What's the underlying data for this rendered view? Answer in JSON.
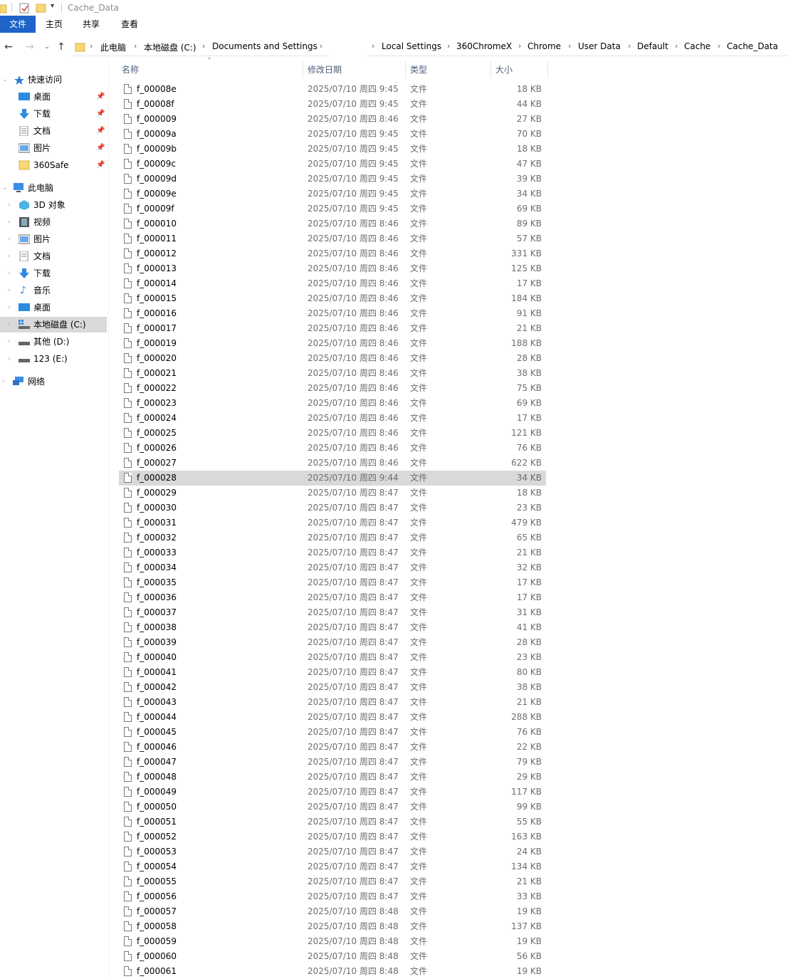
{
  "window": {
    "title": "Cache_Data"
  },
  "ribbon": {
    "tabs": [
      "文件",
      "主页",
      "共享",
      "查看"
    ]
  },
  "address": {
    "left_crumbs": [
      "此电脑",
      "本地磁盘 (C:)",
      "Documents and Settings"
    ],
    "right_crumbs": [
      "Local Settings",
      "360ChromeX",
      "Chrome",
      "User Data",
      "Default",
      "Cache",
      "Cache_Data"
    ]
  },
  "sidebar": {
    "quick_access": {
      "label": "快速访问",
      "items": [
        "桌面",
        "下载",
        "文档",
        "图片",
        "360Safe"
      ]
    },
    "this_pc": {
      "label": "此电脑",
      "items": [
        "3D 对象",
        "视频",
        "图片",
        "文档",
        "下载",
        "音乐",
        "桌面",
        "本地磁盘 (C:)",
        "其他 (D:)",
        "123 (E:)"
      ]
    },
    "network": {
      "label": "网络"
    }
  },
  "columns": {
    "name": "名称",
    "date": "修改日期",
    "type": "类型",
    "size": "大小"
  },
  "files": [
    {
      "name": "f_00008e",
      "date": "2025/07/10 周四 9:45",
      "type": "文件",
      "size": "18 KB"
    },
    {
      "name": "f_00008f",
      "date": "2025/07/10 周四 9:45",
      "type": "文件",
      "size": "44 KB"
    },
    {
      "name": "f_000009",
      "date": "2025/07/10 周四 8:46",
      "type": "文件",
      "size": "27 KB"
    },
    {
      "name": "f_00009a",
      "date": "2025/07/10 周四 9:45",
      "type": "文件",
      "size": "70 KB"
    },
    {
      "name": "f_00009b",
      "date": "2025/07/10 周四 9:45",
      "type": "文件",
      "size": "18 KB"
    },
    {
      "name": "f_00009c",
      "date": "2025/07/10 周四 9:45",
      "type": "文件",
      "size": "47 KB"
    },
    {
      "name": "f_00009d",
      "date": "2025/07/10 周四 9:45",
      "type": "文件",
      "size": "39 KB"
    },
    {
      "name": "f_00009e",
      "date": "2025/07/10 周四 9:45",
      "type": "文件",
      "size": "34 KB"
    },
    {
      "name": "f_00009f",
      "date": "2025/07/10 周四 9:45",
      "type": "文件",
      "size": "69 KB"
    },
    {
      "name": "f_000010",
      "date": "2025/07/10 周四 8:46",
      "type": "文件",
      "size": "89 KB"
    },
    {
      "name": "f_000011",
      "date": "2025/07/10 周四 8:46",
      "type": "文件",
      "size": "57 KB"
    },
    {
      "name": "f_000012",
      "date": "2025/07/10 周四 8:46",
      "type": "文件",
      "size": "331 KB"
    },
    {
      "name": "f_000013",
      "date": "2025/07/10 周四 8:46",
      "type": "文件",
      "size": "125 KB"
    },
    {
      "name": "f_000014",
      "date": "2025/07/10 周四 8:46",
      "type": "文件",
      "size": "17 KB"
    },
    {
      "name": "f_000015",
      "date": "2025/07/10 周四 8:46",
      "type": "文件",
      "size": "184 KB"
    },
    {
      "name": "f_000016",
      "date": "2025/07/10 周四 8:46",
      "type": "文件",
      "size": "91 KB"
    },
    {
      "name": "f_000017",
      "date": "2025/07/10 周四 8:46",
      "type": "文件",
      "size": "21 KB"
    },
    {
      "name": "f_000019",
      "date": "2025/07/10 周四 8:46",
      "type": "文件",
      "size": "188 KB"
    },
    {
      "name": "f_000020",
      "date": "2025/07/10 周四 8:46",
      "type": "文件",
      "size": "28 KB"
    },
    {
      "name": "f_000021",
      "date": "2025/07/10 周四 8:46",
      "type": "文件",
      "size": "38 KB"
    },
    {
      "name": "f_000022",
      "date": "2025/07/10 周四 8:46",
      "type": "文件",
      "size": "75 KB"
    },
    {
      "name": "f_000023",
      "date": "2025/07/10 周四 8:46",
      "type": "文件",
      "size": "69 KB"
    },
    {
      "name": "f_000024",
      "date": "2025/07/10 周四 8:46",
      "type": "文件",
      "size": "17 KB"
    },
    {
      "name": "f_000025",
      "date": "2025/07/10 周四 8:46",
      "type": "文件",
      "size": "121 KB"
    },
    {
      "name": "f_000026",
      "date": "2025/07/10 周四 8:46",
      "type": "文件",
      "size": "76 KB"
    },
    {
      "name": "f_000027",
      "date": "2025/07/10 周四 8:46",
      "type": "文件",
      "size": "622 KB"
    },
    {
      "name": "f_000028",
      "date": "2025/07/10 周四 9:44",
      "type": "文件",
      "size": "34 KB",
      "selected": true
    },
    {
      "name": "f_000029",
      "date": "2025/07/10 周四 8:47",
      "type": "文件",
      "size": "18 KB"
    },
    {
      "name": "f_000030",
      "date": "2025/07/10 周四 8:47",
      "type": "文件",
      "size": "23 KB"
    },
    {
      "name": "f_000031",
      "date": "2025/07/10 周四 8:47",
      "type": "文件",
      "size": "479 KB"
    },
    {
      "name": "f_000032",
      "date": "2025/07/10 周四 8:47",
      "type": "文件",
      "size": "65 KB"
    },
    {
      "name": "f_000033",
      "date": "2025/07/10 周四 8:47",
      "type": "文件",
      "size": "21 KB"
    },
    {
      "name": "f_000034",
      "date": "2025/07/10 周四 8:47",
      "type": "文件",
      "size": "32 KB"
    },
    {
      "name": "f_000035",
      "date": "2025/07/10 周四 8:47",
      "type": "文件",
      "size": "17 KB"
    },
    {
      "name": "f_000036",
      "date": "2025/07/10 周四 8:47",
      "type": "文件",
      "size": "17 KB"
    },
    {
      "name": "f_000037",
      "date": "2025/07/10 周四 8:47",
      "type": "文件",
      "size": "31 KB"
    },
    {
      "name": "f_000038",
      "date": "2025/07/10 周四 8:47",
      "type": "文件",
      "size": "41 KB"
    },
    {
      "name": "f_000039",
      "date": "2025/07/10 周四 8:47",
      "type": "文件",
      "size": "28 KB"
    },
    {
      "name": "f_000040",
      "date": "2025/07/10 周四 8:47",
      "type": "文件",
      "size": "23 KB"
    },
    {
      "name": "f_000041",
      "date": "2025/07/10 周四 8:47",
      "type": "文件",
      "size": "80 KB"
    },
    {
      "name": "f_000042",
      "date": "2025/07/10 周四 8:47",
      "type": "文件",
      "size": "38 KB"
    },
    {
      "name": "f_000043",
      "date": "2025/07/10 周四 8:47",
      "type": "文件",
      "size": "21 KB"
    },
    {
      "name": "f_000044",
      "date": "2025/07/10 周四 8:47",
      "type": "文件",
      "size": "288 KB"
    },
    {
      "name": "f_000045",
      "date": "2025/07/10 周四 8:47",
      "type": "文件",
      "size": "76 KB"
    },
    {
      "name": "f_000046",
      "date": "2025/07/10 周四 8:47",
      "type": "文件",
      "size": "22 KB"
    },
    {
      "name": "f_000047",
      "date": "2025/07/10 周四 8:47",
      "type": "文件",
      "size": "79 KB"
    },
    {
      "name": "f_000048",
      "date": "2025/07/10 周四 8:47",
      "type": "文件",
      "size": "29 KB"
    },
    {
      "name": "f_000049",
      "date": "2025/07/10 周四 8:47",
      "type": "文件",
      "size": "117 KB"
    },
    {
      "name": "f_000050",
      "date": "2025/07/10 周四 8:47",
      "type": "文件",
      "size": "99 KB"
    },
    {
      "name": "f_000051",
      "date": "2025/07/10 周四 8:47",
      "type": "文件",
      "size": "55 KB"
    },
    {
      "name": "f_000052",
      "date": "2025/07/10 周四 8:47",
      "type": "文件",
      "size": "163 KB"
    },
    {
      "name": "f_000053",
      "date": "2025/07/10 周四 8:47",
      "type": "文件",
      "size": "24 KB"
    },
    {
      "name": "f_000054",
      "date": "2025/07/10 周四 8:47",
      "type": "文件",
      "size": "134 KB"
    },
    {
      "name": "f_000055",
      "date": "2025/07/10 周四 8:47",
      "type": "文件",
      "size": "21 KB"
    },
    {
      "name": "f_000056",
      "date": "2025/07/10 周四 8:47",
      "type": "文件",
      "size": "33 KB"
    },
    {
      "name": "f_000057",
      "date": "2025/07/10 周四 8:48",
      "type": "文件",
      "size": "19 KB"
    },
    {
      "name": "f_000058",
      "date": "2025/07/10 周四 8:48",
      "type": "文件",
      "size": "137 KB"
    },
    {
      "name": "f_000059",
      "date": "2025/07/10 周四 8:48",
      "type": "文件",
      "size": "19 KB"
    },
    {
      "name": "f_000060",
      "date": "2025/07/10 周四 8:48",
      "type": "文件",
      "size": "56 KB"
    },
    {
      "name": "f_000061",
      "date": "2025/07/10 周四 8:48",
      "type": "文件",
      "size": "19 KB"
    }
  ],
  "colors": {
    "accent": "#1e64c8",
    "selection": "#d9d9d9",
    "header_text": "#4c607a"
  }
}
